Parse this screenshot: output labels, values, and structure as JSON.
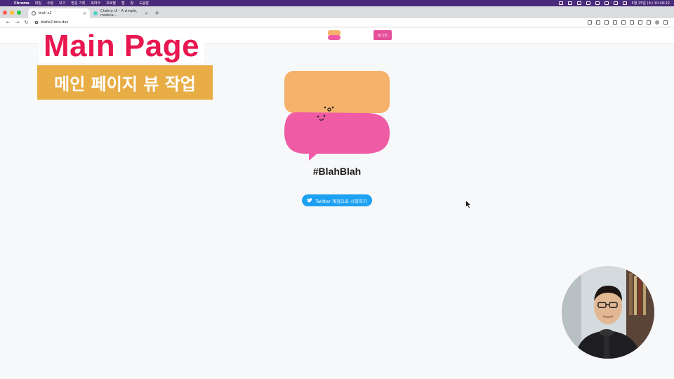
{
  "menubar": {
    "app": "Chrome",
    "items": [
      "파일",
      "수정",
      "보기",
      "방문 기록",
      "북마크",
      "프로필",
      "탭",
      "창",
      "도움말"
    ],
    "datetime": "5월 25일 (수)  10:49:22"
  },
  "tabs": [
    {
      "label": "blah x2",
      "active": true
    },
    {
      "label": "Chakra UI - A simple, modula...",
      "active": false
    }
  ],
  "address": {
    "url": "blahx2.totu.dev"
  },
  "site": {
    "login_label": "로그인"
  },
  "overlay": {
    "title": "Main Page",
    "subtitle": "메인 페이지 뷰 작업"
  },
  "hero": {
    "hashtag": "#BlahBlah",
    "twitter_label": "Twitter 계정으로 시작하기"
  },
  "colors": {
    "accent_pink": "#ef5ba5",
    "accent_orange": "#f6b26b",
    "twitter_blue": "#1da1f2",
    "title_red": "#e8174f",
    "subtitle_bg": "#e9ad45"
  }
}
